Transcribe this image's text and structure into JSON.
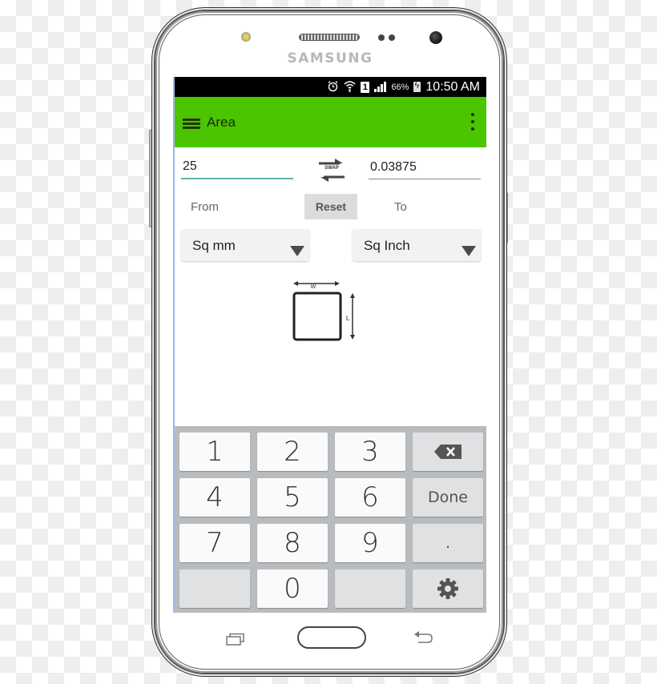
{
  "device": {
    "brand": "SAMSUNG"
  },
  "status_bar": {
    "icons": [
      "alarm-icon",
      "wifi-icon",
      "sim-icon",
      "signal-icon",
      "battery-icon"
    ],
    "sim_label": "1",
    "battery_percent": "66%",
    "time": "10:50 AM"
  },
  "app_bar": {
    "title": "Area",
    "background_color": "#4bc500"
  },
  "converter": {
    "from_value": "25",
    "to_value": "0.03875",
    "swap_label": "SWAP",
    "from_label": "From",
    "to_label": "To",
    "reset_label": "Reset",
    "from_unit": "Sq mm",
    "to_unit": "Sq Inch",
    "diagram_width_label": "W",
    "diagram_length_label": "L"
  },
  "keypad": {
    "keys": [
      {
        "label": "1",
        "type": "num"
      },
      {
        "label": "2",
        "type": "num"
      },
      {
        "label": "3",
        "type": "num"
      },
      {
        "label": "",
        "type": "backspace",
        "icon": "backspace-icon"
      },
      {
        "label": "4",
        "type": "num"
      },
      {
        "label": "5",
        "type": "num"
      },
      {
        "label": "6",
        "type": "num"
      },
      {
        "label": "Done",
        "type": "fn"
      },
      {
        "label": "7",
        "type": "num"
      },
      {
        "label": "8",
        "type": "num"
      },
      {
        "label": "9",
        "type": "num"
      },
      {
        "label": ".",
        "type": "fn"
      },
      {
        "label": "",
        "type": "blank"
      },
      {
        "label": "0",
        "type": "num"
      },
      {
        "label": "",
        "type": "blank"
      },
      {
        "label": "",
        "type": "settings",
        "icon": "gear-icon"
      }
    ]
  },
  "nav_bar": {
    "buttons": [
      "recent-apps",
      "home",
      "back"
    ]
  }
}
